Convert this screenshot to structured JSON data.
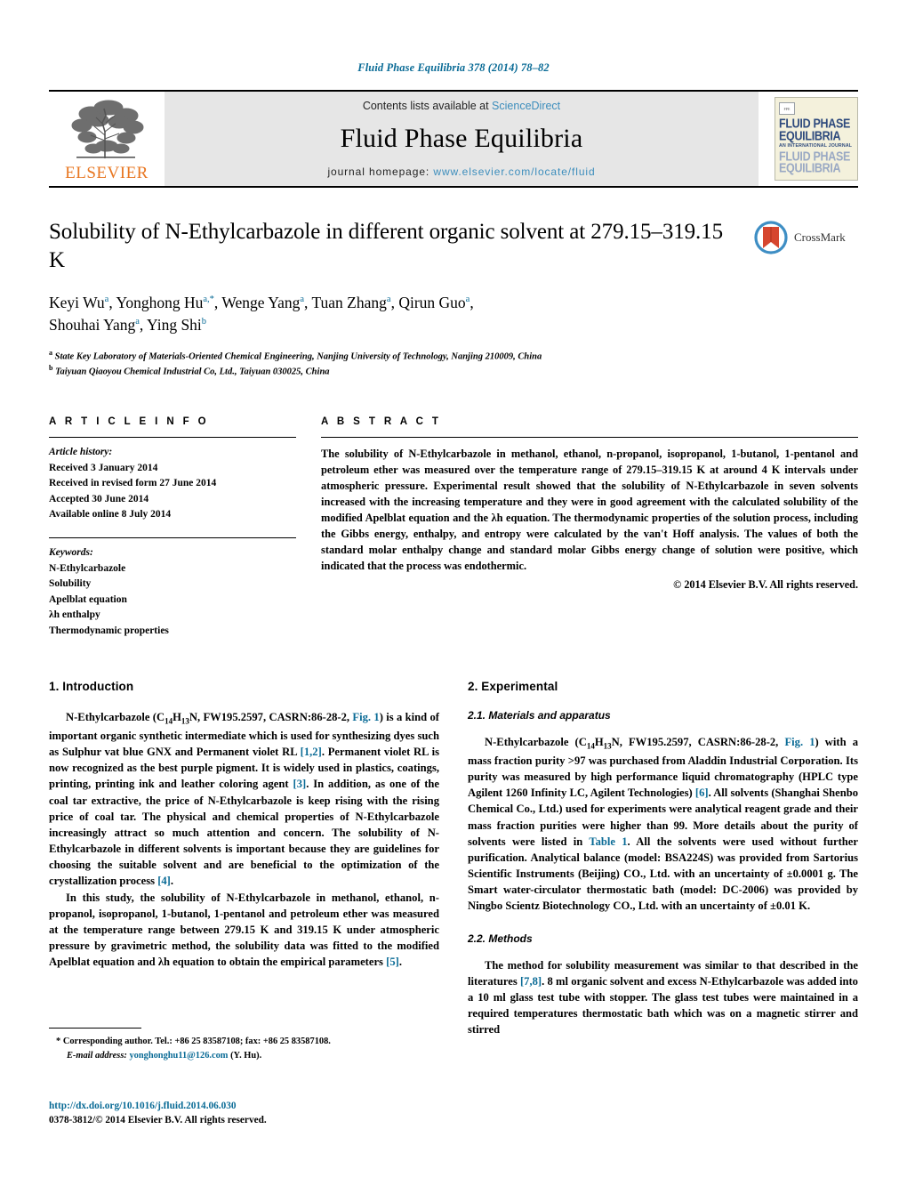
{
  "running_head": "Fluid Phase Equilibria 378 (2014) 78–82",
  "masthead": {
    "publisher": "ELSEVIER",
    "contents_prefix": "Contents lists available at ",
    "contents_link": "ScienceDirect",
    "journal_name": "Fluid Phase Equilibria",
    "homepage_prefix": "journal homepage: ",
    "homepage_url": "www.elsevier.com/locate/fluid",
    "cover": {
      "line1": "FLUID PHASE",
      "line2": "EQUILIBRIA",
      "subtitle": "AN INTERNATIONAL JOURNAL",
      "line3": "FLUID PHASE",
      "line4": "EQUILIBRIA"
    }
  },
  "article": {
    "title": "Solubility of N-Ethylcarbazole in different organic solvent at 279.15–319.15 K",
    "authors_line1": "Keyi Wu",
    "authors": [
      {
        "name": "Keyi Wu",
        "sup": "a"
      },
      {
        "name": "Yonghong Hu",
        "sup": "a,*"
      },
      {
        "name": "Wenge Yang",
        "sup": "a"
      },
      {
        "name": "Tuan Zhang",
        "sup": "a"
      },
      {
        "name": "Qirun Guo",
        "sup": "a"
      },
      {
        "name": "Shouhai Yang",
        "sup": "a"
      },
      {
        "name": "Ying Shi",
        "sup": "b"
      }
    ],
    "affiliations": [
      {
        "sup": "a",
        "text": "State Key Laboratory of Materials-Oriented Chemical Engineering, Nanjing University of Technology, Nanjing 210009, China"
      },
      {
        "sup": "b",
        "text": "Taiyuan Qiaoyou Chemical Industrial Co, Ltd., Taiyuan 030025, China"
      }
    ],
    "crossmark_label": "CrossMark"
  },
  "article_info": {
    "heading": "A R T I C L E   I N F O",
    "history_label": "Article history:",
    "history": [
      "Received 3 January 2014",
      "Received in revised form 27 June 2014",
      "Accepted 30 June 2014",
      "Available online 8 July 2014"
    ],
    "keywords_label": "Keywords:",
    "keywords": [
      "N-Ethylcarbazole",
      "Solubility",
      "Apelblat equation",
      "λh enthalpy",
      "Thermodynamic properties"
    ]
  },
  "abstract": {
    "heading": "A B S T R A C T",
    "text": "The solubility of N-Ethylcarbazole in methanol, ethanol, n-propanol, isopropanol, 1-butanol, 1-pentanol and petroleum ether was measured over the temperature range of 279.15–319.15 K at around 4 K intervals under atmospheric pressure. Experimental result showed that the solubility of N-Ethylcarbazole in seven solvents increased with the increasing temperature and they were in good agreement with the calculated solubility of the modified Apelblat equation and the λh equation. The thermodynamic properties of the solution process, including the Gibbs energy, enthalpy, and entropy were calculated by the van't Hoff analysis. The values of both the standard molar enthalpy change and standard molar Gibbs energy change of solution were positive, which indicated that the process was endothermic.",
    "copyright": "© 2014 Elsevier B.V. All rights reserved."
  },
  "sections": {
    "introduction": {
      "heading": "1.  Introduction",
      "para1_a": "N-Ethylcarbazole  (C",
      "para1_sub1": "14",
      "para1_b": "H",
      "para1_sub2": "13",
      "para1_c": "N,  FW195.2597,  CASRN:86-28-2, ",
      "para1_link1": "Fig. 1",
      "para1_d": ") is a kind of important organic synthetic intermediate which is used for synthesizing dyes such as Sulphur vat blue GNX and Permanent violet RL ",
      "para1_link2": "[1,2]",
      "para1_e": ". Permanent violet RL is now recognized as the best purple pigment. It is widely used in plastics, coatings, printing, printing ink and leather coloring agent ",
      "para1_link3": "[3]",
      "para1_f": ". In addition, as one of the coal tar extractive, the price of N-Ethylcarbazole is keep rising with the rising price of coal tar. The physical and chemical properties of N-Ethylcarbazole increasingly attract so much attention and concern. The solubility of N-Ethylcarbazole in different solvents is important because they are guidelines for choosing the suitable solvent and are beneficial to the optimization of the crystallization process ",
      "para1_link4": "[4]",
      "para1_g": ".",
      "para2_a": "In this study, the solubility of N-Ethylcarbazole in methanol, ethanol, n-propanol, isopropanol, 1-butanol, 1-pentanol and petroleum ether was measured at the temperature range between 279.15 K and 319.15 K under atmospheric pressure by gravimetric method, the solubility data was fitted to the modified Apelblat equation and λh equation to obtain the empirical parameters ",
      "para2_link": "[5]",
      "para2_b": "."
    },
    "experimental": {
      "heading": "2.  Experimental",
      "sub1_heading": "2.1.  Materials and apparatus",
      "sub1_para_a": "N-Ethylcarbazole  (C",
      "sub1_sub1": "14",
      "sub1_para_b": "H",
      "sub1_sub2": "13",
      "sub1_para_c": "N,  FW195.2597,  CASRN:86-28-2, ",
      "sub1_link1": "Fig. 1",
      "sub1_para_d": ") with a mass fraction purity >97 was purchased from Aladdin Industrial Corporation. Its purity was measured by high performance liquid chromatography (HPLC type Agilent 1260 Infinity LC, Agilent Technologies) ",
      "sub1_link2": "[6]",
      "sub1_para_e": ". All solvents (Shanghai Shenbo Chemical Co., Ltd.) used for experiments were analytical reagent grade and their mass fraction purities were higher than 99. More details about the purity of solvents were listed in ",
      "sub1_link3": "Table 1",
      "sub1_para_f": ". All the solvents were used without further purification. Analytical balance (model: BSA224S) was provided from Sartorius Scientific Instruments (Beijing) CO., Ltd. with an uncertainty of ±0.0001 g. The Smart water-circulator thermostatic bath (model: DC-2006) was provided by Ningbo Scientz Biotechnology CO., Ltd. with an uncertainty of ±0.01 K.",
      "sub2_heading": "2.2.  Methods",
      "sub2_para_a": "The method for solubility measurement was similar to that described in the literatures ",
      "sub2_link1": "[7,8]",
      "sub2_para_b": ". 8 ml organic solvent and excess N-Ethylcarbazole was added into a 10 ml glass test tube with stopper. The glass test tubes were maintained in a required temperatures thermostatic bath which was on a magnetic stirrer and stirred"
    }
  },
  "footer": {
    "corresponding_marker": "*",
    "corresponding": "Corresponding author. Tel.: +86 25 83587108; fax: +86 25 83587108.",
    "email_label": "E-mail address:",
    "email": "yonghonghu11@126.com",
    "email_suffix": "(Y. Hu).",
    "doi": "http://dx.doi.org/10.1016/j.fluid.2014.06.030",
    "issn_line": "0378-3812/© 2014 Elsevier B.V. All rights reserved."
  },
  "colors": {
    "link": "#0a6b96",
    "sciencedirect": "#3c8dbc",
    "elsevier_orange": "#E87722",
    "cover_blue": "#2e4a7d",
    "crossmark_red": "#d6462f",
    "crossmark_blue": "#3e8ec4"
  }
}
